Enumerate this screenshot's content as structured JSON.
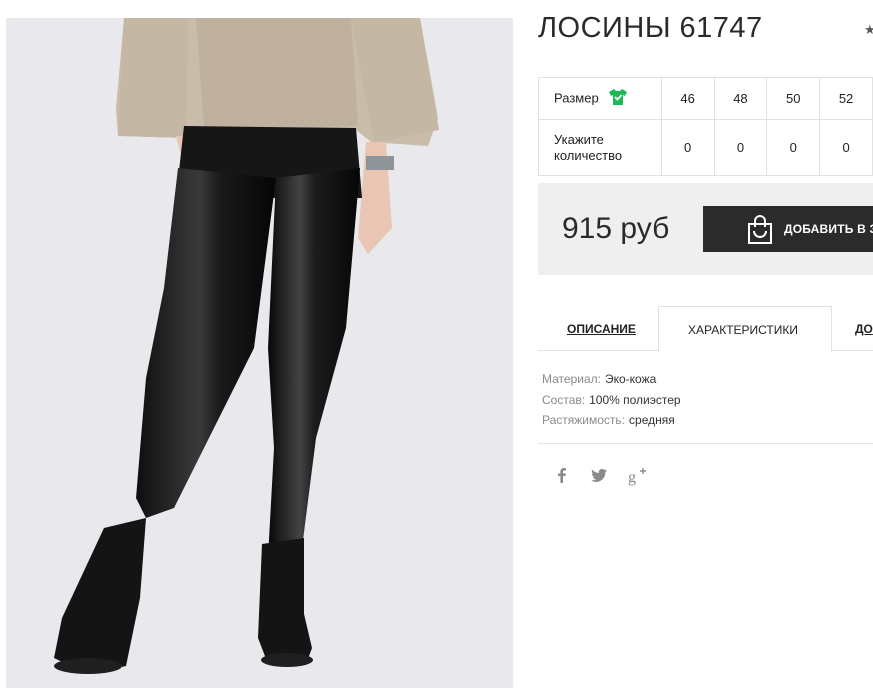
{
  "product": {
    "title": "ЛОСИНЫ 61747",
    "fav_icon": "star-icon"
  },
  "size_table": {
    "row1_label": "Размер",
    "size_icon": "tshirt-check-icon",
    "sizes": [
      "46",
      "48",
      "50",
      "52"
    ],
    "row2_label_line1": "Укажите",
    "row2_label_line2": "количество",
    "quantities": [
      "0",
      "0",
      "0",
      "0"
    ]
  },
  "purchase": {
    "price": "915 руб",
    "add_button_label": "ДОБАВИТЬ В З",
    "add_button_icon": "shopping-bag-icon"
  },
  "tabs": {
    "items": [
      "ОПИСАНИЕ",
      "ХАРАКТЕРИСТИКИ",
      "ДО"
    ],
    "active_index": 1
  },
  "characteristics": [
    {
      "key": "Материал:",
      "value": "Эко-кожа"
    },
    {
      "key": "Состав:",
      "value": "100% полиэстер"
    },
    {
      "key": "Растяжимость:",
      "value": "средняя"
    }
  ],
  "social": [
    "facebook-icon",
    "twitter-icon",
    "google-plus-icon"
  ],
  "colors": {
    "button_bg": "#2b2b2b",
    "price_bg": "#efefef",
    "size_icon": "#1db954",
    "photo_bg": "#e9e9ed"
  }
}
